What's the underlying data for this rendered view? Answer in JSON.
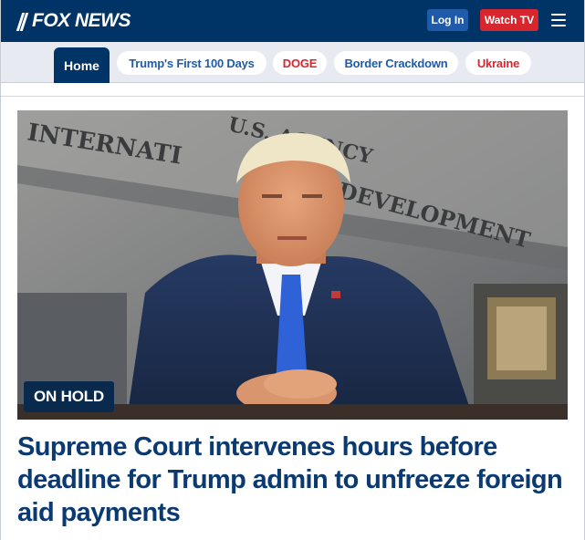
{
  "header": {
    "logo_text": "FOX NEWS",
    "login_label": "Log In",
    "watch_label": "Watch TV",
    "menu_icon": "hamburger-menu-icon"
  },
  "nav": {
    "items": [
      {
        "label": "Home",
        "active": true
      },
      {
        "label": "Trump's First 100 Days",
        "color": "blue"
      },
      {
        "label": "DOGE",
        "color": "red"
      },
      {
        "label": "Border Crackdown",
        "color": "blue"
      },
      {
        "label": "Ukraine",
        "color": "red"
      }
    ]
  },
  "story": {
    "image_sign_lines": [
      "INTERNATI",
      "U.S. AGENCY",
      "DEVELOPMENT"
    ],
    "label": "ON HOLD",
    "headline": "Supreme Court intervenes hours before deadline for Trump admin to unfreeze foreign aid payments"
  },
  "colors": {
    "header_bg": "#003366",
    "nav_bg": "#e7ebf1",
    "accent_red": "#d7262e",
    "accent_blue": "#1f5ba8",
    "headline": "#0b3a73"
  }
}
